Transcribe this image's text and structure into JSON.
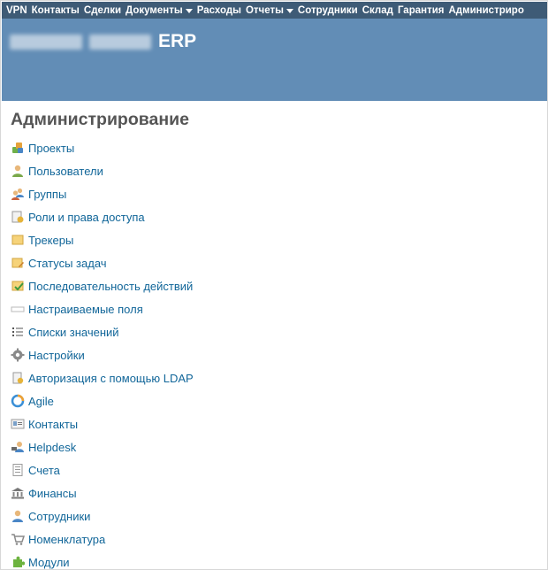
{
  "top_menu": {
    "items": [
      {
        "label": "VPN"
      },
      {
        "label": "Контакты"
      },
      {
        "label": "Сделки"
      },
      {
        "label": "Документы",
        "dropdown": true
      },
      {
        "label": "Расходы"
      },
      {
        "label": "Отчеты",
        "dropdown": true
      },
      {
        "label": "Сотрудники"
      },
      {
        "label": "Склад"
      },
      {
        "label": "Гарантия"
      },
      {
        "label": "Администриро"
      }
    ]
  },
  "header": {
    "title_suffix": "ERP"
  },
  "page_title": "Администрирование",
  "admin_items": [
    {
      "label": "Проекты",
      "icon": "projects-icon"
    },
    {
      "label": "Пользователи",
      "icon": "user-icon"
    },
    {
      "label": "Группы",
      "icon": "group-icon"
    },
    {
      "label": "Роли и права доступа",
      "icon": "roles-icon"
    },
    {
      "label": "Трекеры",
      "icon": "tracker-icon"
    },
    {
      "label": "Статусы задач",
      "icon": "issue-status-icon"
    },
    {
      "label": "Последовательность действий",
      "icon": "workflow-icon"
    },
    {
      "label": "Настраиваемые поля",
      "icon": "custom-fields-icon"
    },
    {
      "label": "Списки значений",
      "icon": "list-icon"
    },
    {
      "label": "Настройки",
      "icon": "gear-icon"
    },
    {
      "label": "Авторизация с помощью LDAP",
      "icon": "ldap-icon"
    },
    {
      "label": "Agile",
      "icon": "agile-icon"
    },
    {
      "label": "Контакты",
      "icon": "contacts-card-icon"
    },
    {
      "label": "Helpdesk",
      "icon": "helpdesk-icon"
    },
    {
      "label": "Счета",
      "icon": "invoice-icon"
    },
    {
      "label": "Финансы",
      "icon": "bank-icon"
    },
    {
      "label": "Сотрудники",
      "icon": "employee-icon"
    },
    {
      "label": "Номенклатура",
      "icon": "cart-icon"
    },
    {
      "label": "Модули",
      "icon": "plugin-icon"
    }
  ],
  "colors": {
    "top_menu_bg": "#3e5b76",
    "header_bg": "#628db6",
    "link": "#116699",
    "title": "#555555"
  }
}
